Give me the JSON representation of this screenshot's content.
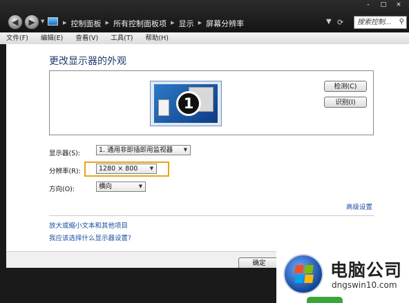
{
  "window": {
    "controls": [
      "-",
      "□",
      "×"
    ]
  },
  "nav": {
    "back_icon": "back-arrow-icon",
    "forward_icon": "forward-arrow-icon",
    "breadcrumbs": [
      "控制面板",
      "所有控制面板项",
      "显示",
      "屏幕分辨率"
    ],
    "search_placeholder": "搜索控制..."
  },
  "menubar": [
    "文件(F)",
    "编辑(E)",
    "查看(V)",
    "工具(T)",
    "帮助(H)"
  ],
  "main": {
    "title": "更改显示器的外观",
    "monitor_number": "1",
    "detect_label": "检测(C)",
    "identify_label": "识别(I)",
    "display_label": "显示器(S):",
    "display_value": "1. 通用非即插即用监视器",
    "resolution_label": "分辨率(R):",
    "resolution_value": "1280 × 800",
    "orientation_label": "方向(O):",
    "orientation_value": "横向",
    "advanced_link": "高级设置",
    "link_text_size": "放大或缩小文本和其他项目",
    "link_help": "我应该选择什么显示器设置?"
  },
  "footer": {
    "ok_label": "确定"
  },
  "watermark": {
    "title": "电脑公司",
    "url": "dngswin10.com"
  },
  "colors": {
    "highlight": "#e8a317",
    "link": "#1a4fa0"
  }
}
